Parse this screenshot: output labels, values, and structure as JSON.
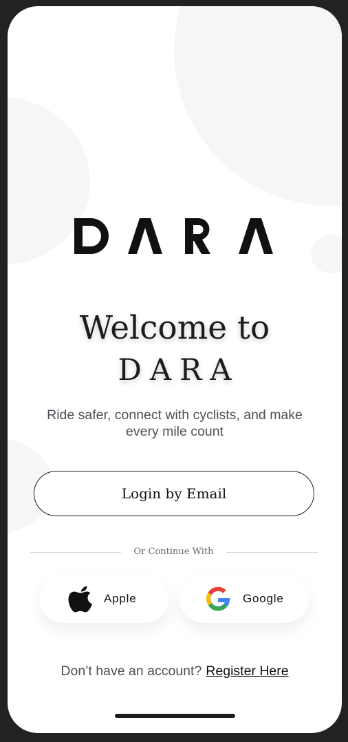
{
  "brand": {
    "logo_text": "DARA"
  },
  "welcome": {
    "line1": "Welcome to",
    "line2": "DARA"
  },
  "subtitle": "Ride safer, connect with cyclists, and make every mile count",
  "login_button": "Login by Email",
  "divider_text": "Or Continue With",
  "social": [
    {
      "label": "Apple",
      "icon": "apple-icon"
    },
    {
      "label": "Google",
      "icon": "google-icon"
    }
  ],
  "register": {
    "prompt": "Don’t have an account?",
    "link": "Register Here"
  },
  "colors": {
    "background": "#ffffff",
    "frame": "#222222",
    "text_dark": "#111111",
    "text_muted": "#4e4e56",
    "bg_circles": "#f6f6f6"
  }
}
